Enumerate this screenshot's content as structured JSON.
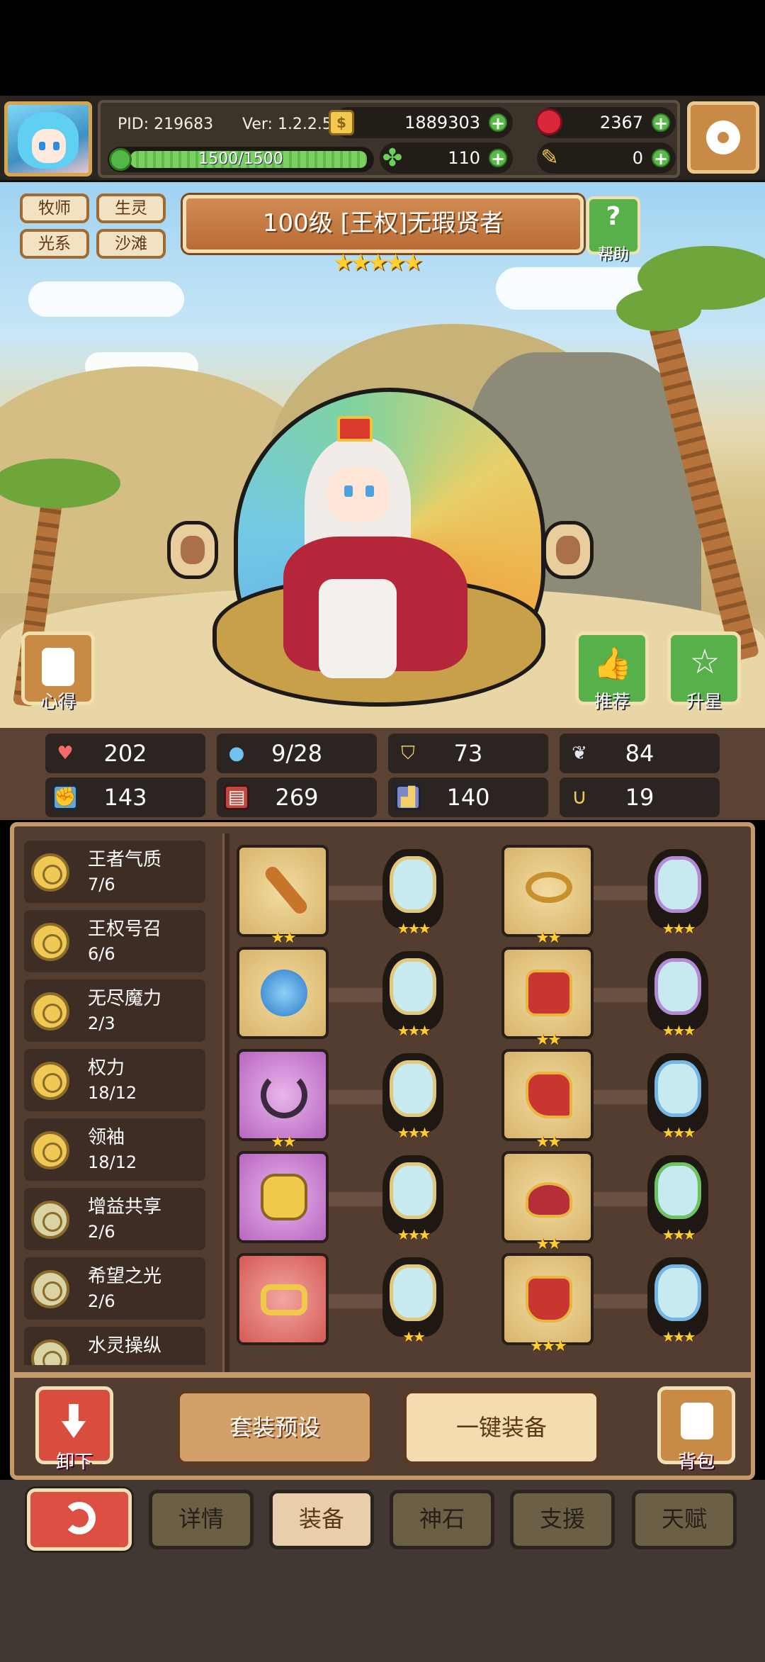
{
  "header": {
    "pid": "PID: 219683",
    "version": "Ver: 1.2.2.5",
    "gold": "1889303",
    "ruby": "2367",
    "clover": "110",
    "ticket": "0",
    "energy": "1500/1500"
  },
  "hero": {
    "title": "100级  [王权]无瑕贤者",
    "stars": "★★★★★",
    "tags": [
      "牧师",
      "生灵",
      "光系",
      "沙滩"
    ],
    "help_label": "帮助",
    "notes_label": "心得",
    "recommend_label": "推荐",
    "upgrade_label": "升星"
  },
  "stats": {
    "hp": "202",
    "mana": "9/28",
    "defense": "73",
    "speed": "84",
    "attack": "143",
    "magic": "269",
    "armor": "140",
    "luck": "19"
  },
  "skills": [
    {
      "name": "王者气质",
      "level": "7/6"
    },
    {
      "name": "王权号召",
      "level": "6/6"
    },
    {
      "name": "无尽魔力",
      "level": "2/3"
    },
    {
      "name": "权力",
      "level": "18/12"
    },
    {
      "name": "领袖",
      "level": "18/12"
    },
    {
      "name": "增益共享",
      "level": "2/6"
    },
    {
      "name": "希望之光",
      "level": "2/6"
    },
    {
      "name": "水灵操纵",
      "level": ""
    }
  ],
  "equipment": {
    "left": [
      {
        "icon": "scepter-icon",
        "stars": "★★",
        "gem_stars": "★★★"
      },
      {
        "icon": "orb-icon",
        "stars": "",
        "gem_stars": "★★★"
      },
      {
        "icon": "necklace-icon",
        "stars": "★★",
        "gem_stars": "★★★"
      },
      {
        "icon": "crown-icon",
        "stars": "",
        "gem_stars": "★★★"
      },
      {
        "icon": "ring-icon",
        "stars": "",
        "gem_stars": "★★"
      }
    ],
    "right": [
      {
        "icon": "tiara-icon",
        "stars": "★★",
        "gem_stars": "★★★"
      },
      {
        "icon": "robe-icon",
        "stars": "★★",
        "gem_stars": "★★★"
      },
      {
        "icon": "gloves-icon",
        "stars": "★★",
        "gem_stars": "★★★"
      },
      {
        "icon": "belt-icon",
        "stars": "★★",
        "gem_stars": "★★★"
      },
      {
        "icon": "boots-icon",
        "stars": "★★★",
        "gem_stars": "★★★"
      }
    ]
  },
  "actions": {
    "unequip": "卸下",
    "preset": "套装预设",
    "one_click": "一键装备",
    "bag": "背包"
  },
  "nav": {
    "tabs": [
      "详情",
      "装备",
      "神石",
      "支援",
      "天赋"
    ],
    "active": "装备"
  },
  "colors": {
    "panel": "#523d30",
    "accent_gold": "#ffcf2e",
    "green": "#58b04a",
    "red": "#de4f43"
  }
}
